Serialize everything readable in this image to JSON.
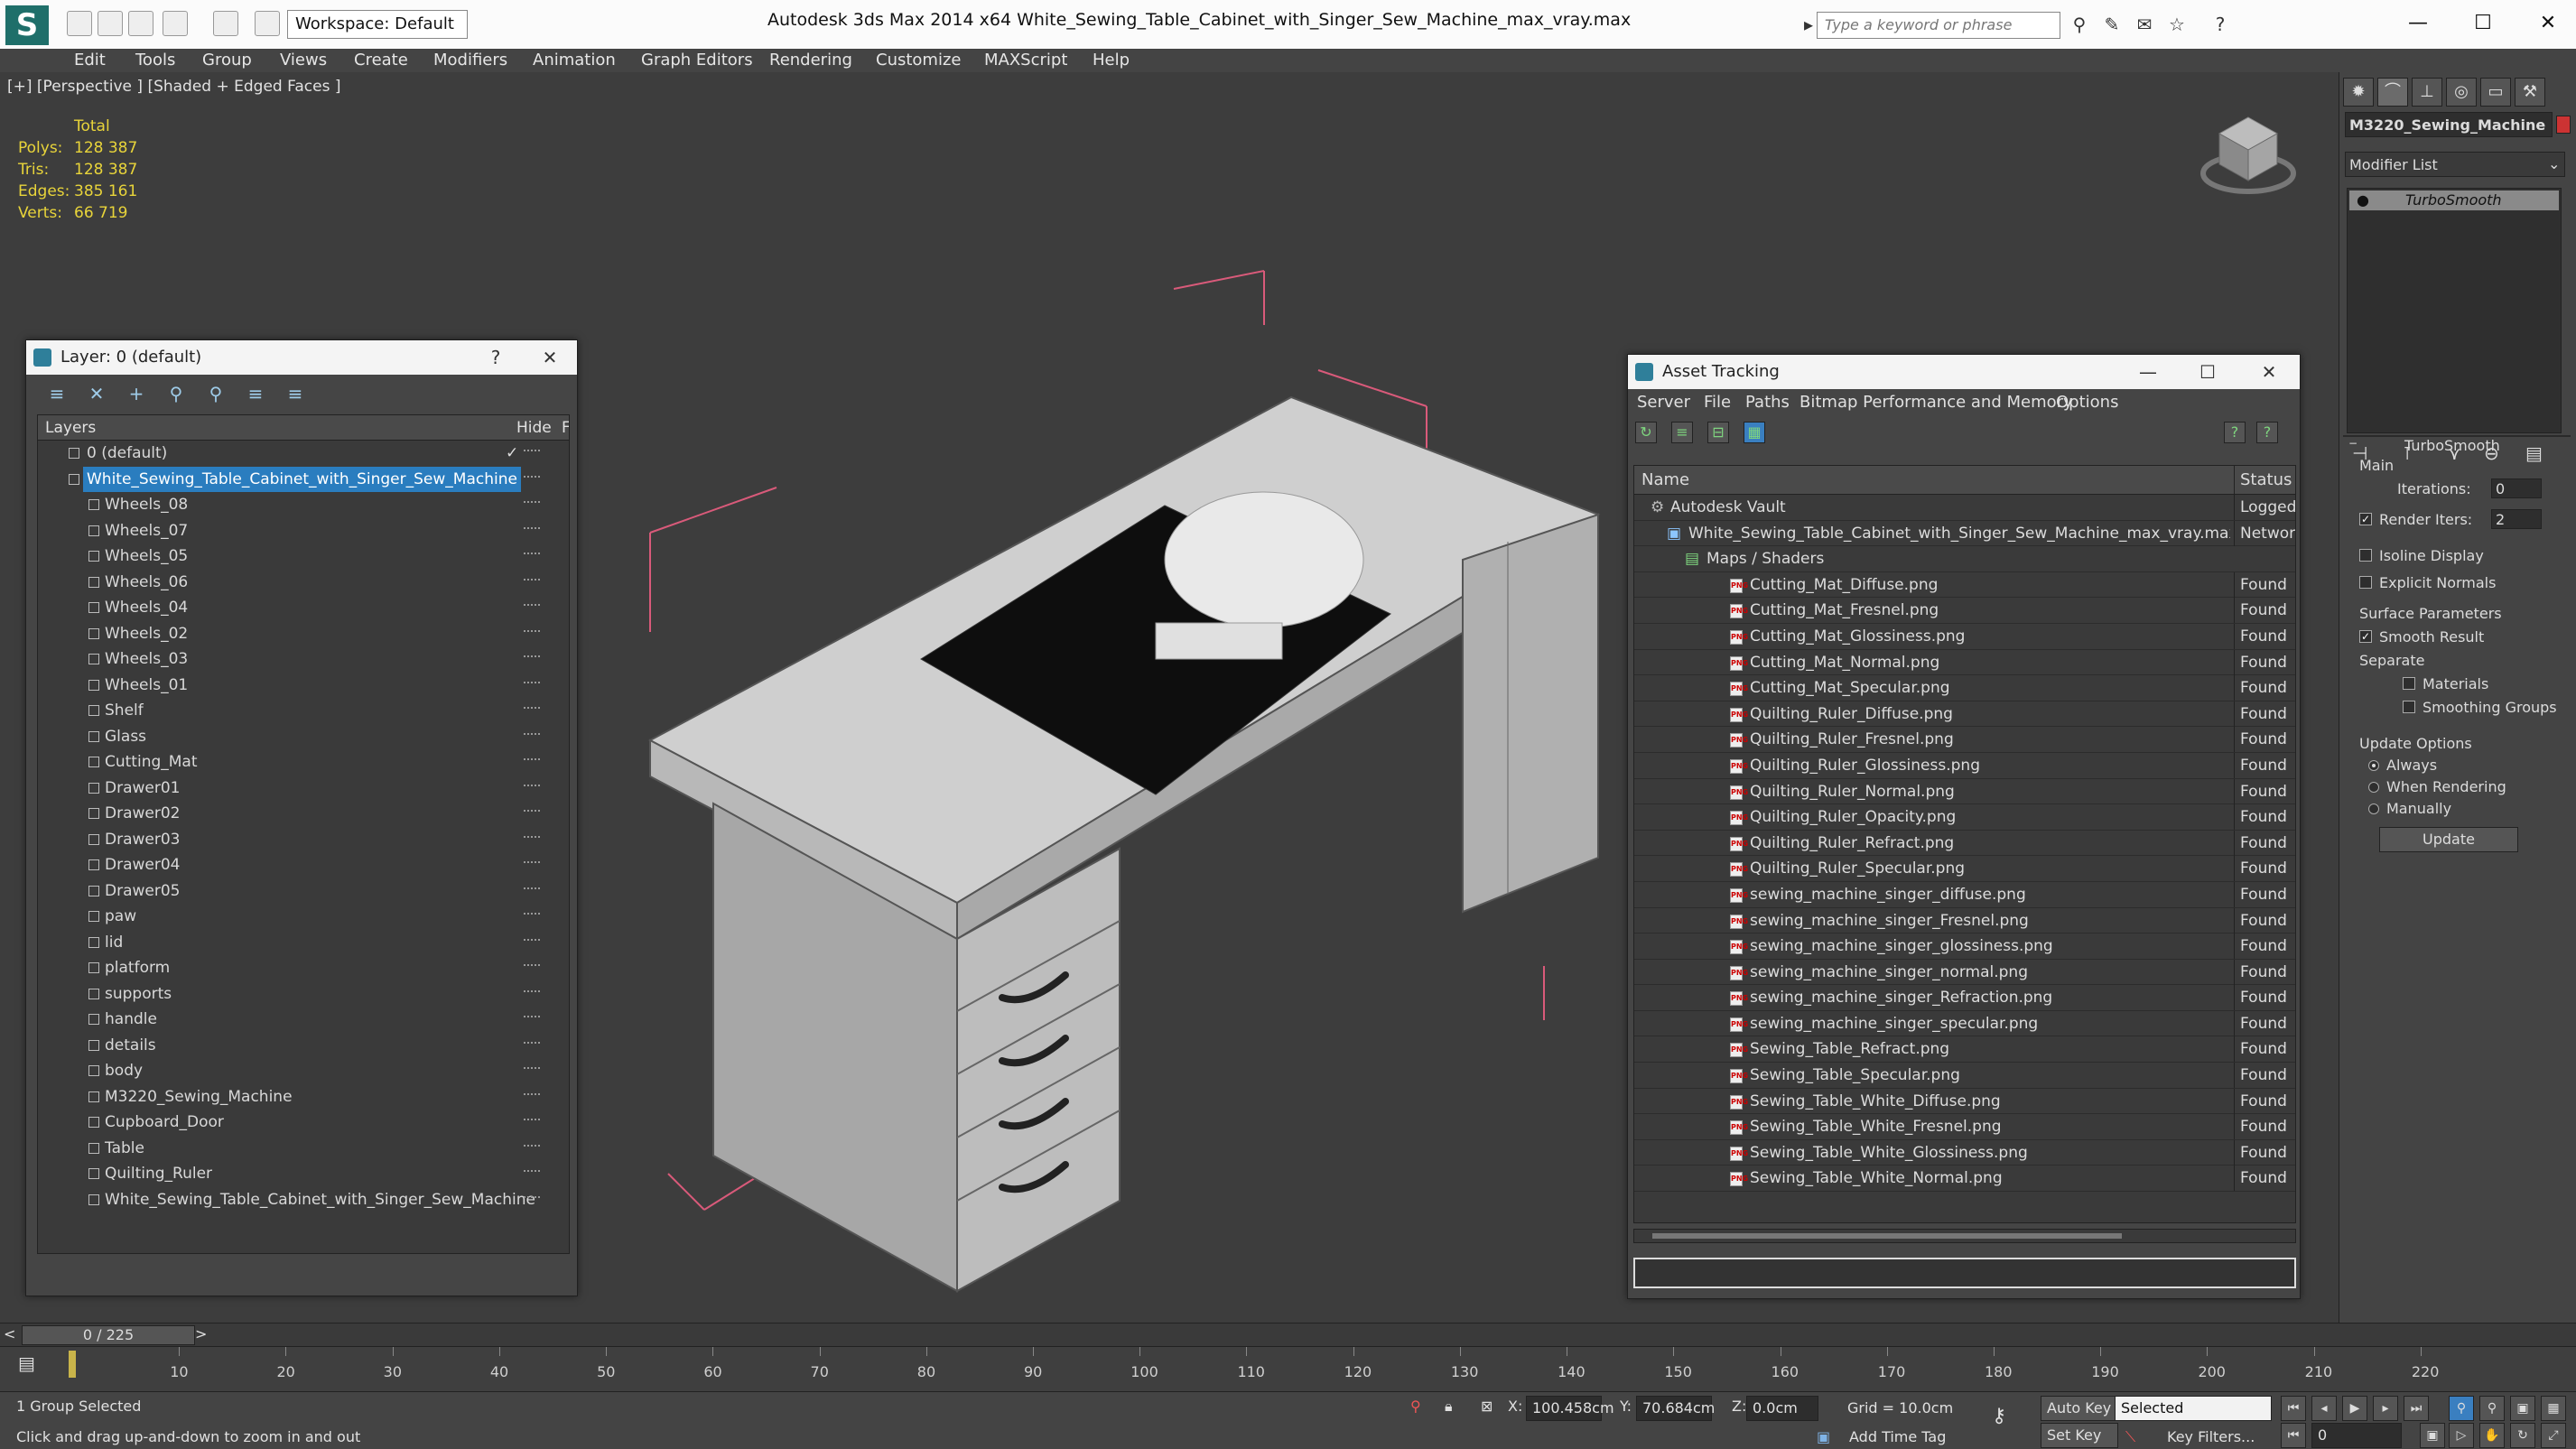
{
  "title_bar": {
    "app_logo": "S",
    "workspace": "Workspace: Default",
    "title": "Autodesk 3ds Max  2014 x64     White_Sewing_Table_Cabinet_with_Singer_Sew_Machine_max_vray.max",
    "search_placeholder": "Type a keyword or phrase"
  },
  "menu": [
    "Edit",
    "Tools",
    "Group",
    "Views",
    "Create",
    "Modifiers",
    "Animation",
    "Graph Editors",
    "Rendering",
    "Customize",
    "MAXScript",
    "Help"
  ],
  "viewport": {
    "label": "[+] [Perspective ] [Shaded + Edged Faces ]",
    "stats": {
      "header": "Total",
      "polys_label": "Polys:",
      "polys": "128 387",
      "tris_label": "Tris:",
      "tris": "128 387",
      "edges_label": "Edges:",
      "edges": "385 161",
      "verts_label": "Verts:",
      "verts": "66 719"
    }
  },
  "layer_window": {
    "title": "Layer: 0 (default)",
    "col_layers": "Layers",
    "col_hide": "Hide",
    "col_f": "F",
    "rows": [
      "0 (default)",
      "White_Sewing_Table_Cabinet_with_Singer_Sew_Machine",
      "Wheels_08",
      "Wheels_07",
      "Wheels_05",
      "Wheels_06",
      "Wheels_04",
      "Wheels_02",
      "Wheels_03",
      "Wheels_01",
      "Shelf",
      "Glass",
      "Cutting_Mat",
      "Drawer01",
      "Drawer02",
      "Drawer03",
      "Drawer04",
      "Drawer05",
      "paw",
      "lid",
      "platform",
      "supports",
      "handle",
      "details",
      "body",
      "M3220_Sewing_Machine",
      "Cupboard_Door",
      "Table",
      "Quilting_Ruler",
      "White_Sewing_Table_Cabinet_with_Singer_Sew_Machine"
    ]
  },
  "asset_window": {
    "title": "Asset Tracking",
    "menu": [
      "Server",
      "File",
      "Paths",
      "Bitmap Performance and Memory",
      "Options"
    ],
    "col_name": "Name",
    "col_status": "Status",
    "vault": {
      "name": "Autodesk Vault",
      "status": "Logged O"
    },
    "scene_file": {
      "name": "White_Sewing_Table_Cabinet_with_Singer_Sew_Machine_max_vray.max",
      "status": "Network"
    },
    "maps_group": "Maps / Shaders",
    "maps": [
      {
        "name": "Cutting_Mat_Diffuse.png",
        "status": "Found"
      },
      {
        "name": "Cutting_Mat_Fresnel.png",
        "status": "Found"
      },
      {
        "name": "Cutting_Mat_Glossiness.png",
        "status": "Found"
      },
      {
        "name": "Cutting_Mat_Normal.png",
        "status": "Found"
      },
      {
        "name": "Cutting_Mat_Specular.png",
        "status": "Found"
      },
      {
        "name": "Quilting_Ruler_Diffuse.png",
        "status": "Found"
      },
      {
        "name": "Quilting_Ruler_Fresnel.png",
        "status": "Found"
      },
      {
        "name": "Quilting_Ruler_Glossiness.png",
        "status": "Found"
      },
      {
        "name": "Quilting_Ruler_Normal.png",
        "status": "Found"
      },
      {
        "name": "Quilting_Ruler_Opacity.png",
        "status": "Found"
      },
      {
        "name": "Quilting_Ruler_Refract.png",
        "status": "Found"
      },
      {
        "name": "Quilting_Ruler_Specular.png",
        "status": "Found"
      },
      {
        "name": "sewing_machine_singer_diffuse.png",
        "status": "Found"
      },
      {
        "name": "sewing_machine_singer_Fresnel.png",
        "status": "Found"
      },
      {
        "name": "sewing_machine_singer_glossiness.png",
        "status": "Found"
      },
      {
        "name": "sewing_machine_singer_normal.png",
        "status": "Found"
      },
      {
        "name": "sewing_machine_singer_Refraction.png",
        "status": "Found"
      },
      {
        "name": "sewing_machine_singer_specular.png",
        "status": "Found"
      },
      {
        "name": "Sewing_Table_Refract.png",
        "status": "Found"
      },
      {
        "name": "Sewing_Table_Specular.png",
        "status": "Found"
      },
      {
        "name": "Sewing_Table_White_Diffuse.png",
        "status": "Found"
      },
      {
        "name": "Sewing_Table_White_Fresnel.png",
        "status": "Found"
      },
      {
        "name": "Sewing_Table_White_Glossiness.png",
        "status": "Found"
      },
      {
        "name": "Sewing_Table_White_Normal.png",
        "status": "Found"
      }
    ]
  },
  "command_panel": {
    "object_name": "M3220_Sewing_Machine",
    "modifier_list": "Modifier List",
    "stack_item": "TurboSmooth",
    "rollout_title": "TurboSmooth",
    "main_group": "Main",
    "iterations_label": "Iterations:",
    "iterations": "0",
    "render_iters_label": "Render Iters:",
    "render_iters": "2",
    "isoline": "Isoline Display",
    "explicit_normals": "Explicit Normals",
    "surface_group": "Surface Parameters",
    "smooth_result": "Smooth Result",
    "separate": "Separate",
    "materials": "Materials",
    "smoothing_groups": "Smoothing Groups",
    "update_group": "Update Options",
    "always": "Always",
    "when_rendering": "When Rendering",
    "manually": "Manually",
    "update_button": "Update"
  },
  "timeline": {
    "frame": "0 / 225",
    "ticks": [
      "10",
      "20",
      "30",
      "40",
      "50",
      "60",
      "70",
      "80",
      "90",
      "100",
      "110",
      "120",
      "130",
      "140",
      "150",
      "160",
      "170",
      "180",
      "190",
      "200",
      "210",
      "220"
    ]
  },
  "status": {
    "selection": "1 Group Selected",
    "prompt": "Click and drag up-and-down to zoom in and out",
    "x_label": "X:",
    "x": "100.458cm",
    "y_label": "Y:",
    "y": "70.684cm",
    "z_label": "Z:",
    "z": "0.0cm",
    "grid": "Grid = 10.0cm",
    "add_time_tag": "Add Time Tag",
    "auto_key": "Auto Key",
    "selected": "Selected",
    "set_key": "Set Key",
    "key_filters": "Key Filters...",
    "frame_field": "0"
  },
  "colors": {
    "accent": "#2a7dbf",
    "stats_yellow": "#e8d43a",
    "bbox_pink": "#d95a7a"
  }
}
